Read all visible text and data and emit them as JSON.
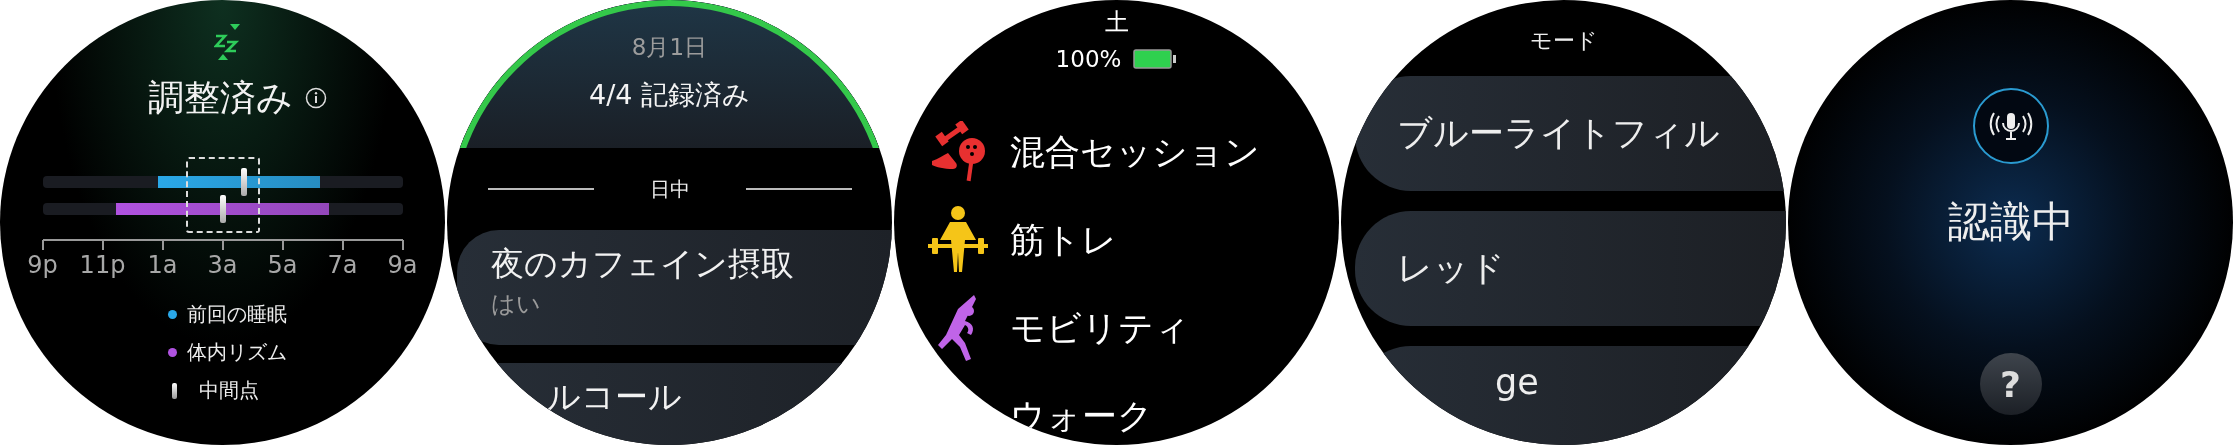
{
  "screens": [
    {
      "kind": "sleep",
      "title": "調整済み",
      "axis_labels": [
        "9p",
        "11p",
        "1a",
        "3a",
        "5a",
        "7a",
        "9a"
      ],
      "legend": [
        {
          "kind": "dot",
          "label": "前回の睡眠",
          "color": "#2aa8e8"
        },
        {
          "kind": "dot",
          "label": "体内リズム",
          "color": "#b052e0"
        },
        {
          "kind": "marker",
          "label": "中間点"
        }
      ]
    },
    {
      "kind": "log",
      "date": "8月1日",
      "summary": "4/4 記録済み",
      "section": "日中",
      "items": [
        {
          "title": "夜のカフェイン摂取",
          "value": "はい"
        },
        {
          "title": "ルコール"
        }
      ]
    },
    {
      "kind": "workouts",
      "day": "土",
      "battery": "100%",
      "items": [
        {
          "kind": "mixed",
          "label": "混合セッション"
        },
        {
          "kind": "strength",
          "label": "筋トレ"
        },
        {
          "kind": "mobility",
          "label": "モビリティ"
        },
        {
          "label": "ウォーク"
        }
      ]
    },
    {
      "kind": "options",
      "title": "モード",
      "items": [
        "ブルーライトフィル",
        "レッド",
        "ge"
      ]
    },
    {
      "kind": "voice",
      "status": "認識中",
      "help": "?"
    }
  ]
}
